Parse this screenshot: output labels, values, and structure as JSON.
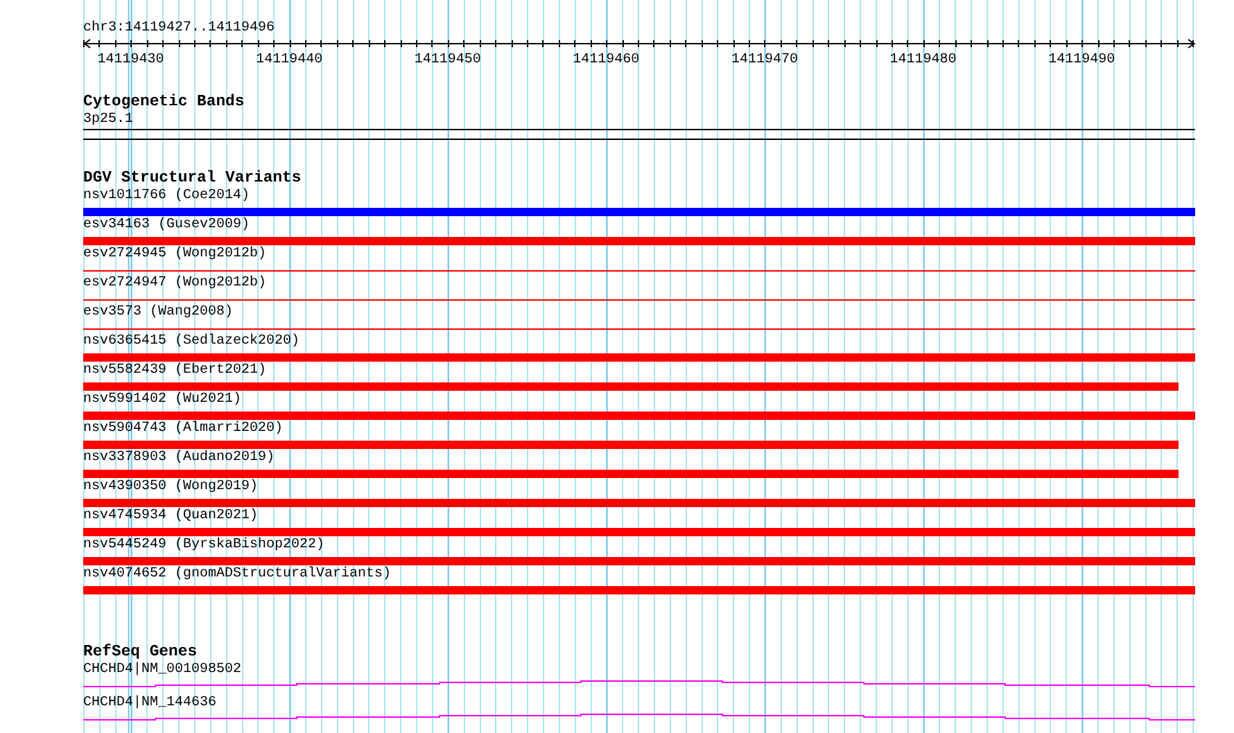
{
  "ruler": {
    "location": "chr3:14119427..14119496",
    "ticks": [
      "14119430",
      "14119440",
      "14119450",
      "14119460",
      "14119470",
      "14119480",
      "14119490"
    ]
  },
  "cytogenetic_bands": {
    "title": "Cytogenetic Bands",
    "bands": [
      {
        "label": "3p25.1"
      }
    ]
  },
  "dgv_structural_variants": {
    "title": "DGV Structural Variants",
    "variants": [
      {
        "label": "nsv1011766 (Coe2014)",
        "kind": "thick",
        "color": "#0000ff",
        "full_width": true
      },
      {
        "label": "esv34163 (Gusev2009)",
        "kind": "thick",
        "color": "#ff0000",
        "full_width": true
      },
      {
        "label": "esv2724945 (Wong2012b)",
        "kind": "thin",
        "color": "#ff0000",
        "full_width": true
      },
      {
        "label": "esv2724947 (Wong2012b)",
        "kind": "thin",
        "color": "#ff0000",
        "full_width": true
      },
      {
        "label": "esv3573 (Wang2008)",
        "kind": "thin",
        "color": "#ff0000",
        "full_width": true
      },
      {
        "label": "nsv6365415 (Sedlazeck2020)",
        "kind": "thick",
        "color": "#ff0000",
        "full_width": true
      },
      {
        "label": "nsv5582439 (Ebert2021)",
        "kind": "thick",
        "color": "#ff0000",
        "full_width": false
      },
      {
        "label": "nsv5991402 (Wu2021)",
        "kind": "thick",
        "color": "#ff0000",
        "full_width": true
      },
      {
        "label": "nsv5904743 (Almarri2020)",
        "kind": "thick",
        "color": "#ff0000",
        "full_width": false
      },
      {
        "label": "nsv3378903 (Audano2019)",
        "kind": "thick",
        "color": "#ff0000",
        "full_width": false
      },
      {
        "label": "nsv4390350 (Wong2019)",
        "kind": "thick",
        "color": "#ff0000",
        "full_width": true
      },
      {
        "label": "nsv4745934 (Quan2021)",
        "kind": "thick",
        "color": "#ff0000",
        "full_width": true
      },
      {
        "label": "nsv5445249 (ByrskaBishop2022)",
        "kind": "thick",
        "color": "#ff0000",
        "full_width": true
      },
      {
        "label": "nsv4074652 (gnomADStructuralVariants)",
        "kind": "thick",
        "color": "#ff0000",
        "full_width": true
      }
    ]
  },
  "refseq_genes": {
    "title": "RefSeq Genes",
    "transcripts": [
      {
        "label": "CHCHD4|NM_001098502"
      },
      {
        "label": "CHCHD4|NM_144636"
      }
    ]
  }
}
